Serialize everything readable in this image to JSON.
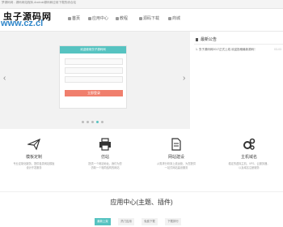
{
  "topbar": {
    "text": "梦源码网 - 源码网站程序,Android源码和应用下载的综合站"
  },
  "logo": {
    "cn": "虫子源码网",
    "url": "www.cz.cl"
  },
  "nav": {
    "items": [
      {
        "label": "首页",
        "active": true
      },
      {
        "label": "应用中心"
      },
      {
        "label": "教程"
      },
      {
        "label": "源码下载"
      },
      {
        "label": "商城"
      }
    ]
  },
  "slider": {
    "panel_title": "欢迎使用虫子源码网",
    "button_label": "立即登录",
    "dots": 5,
    "active_dot": 3
  },
  "announce": {
    "title": "最新公告",
    "items": [
      {
        "text": "1. 虫子源码网2017正式上线 欢迎投稿最新源码！",
        "date": "03-03"
      }
    ]
  },
  "features": [
    {
      "icon": "paper-plane-icon",
      "title": "模板定制",
      "desc": "专业定制化服务，提供各类网站模板\n设计开发服务"
    },
    {
      "icon": "printer-icon",
      "title": "仿站",
      "desc": "提供一个网站地址，我们为您\n仿制一个相同结构的网站"
    },
    {
      "icon": "document-icon",
      "title": "网站建设",
      "desc": "从需求分析到上线运营，为您提供\n一站式网站建设服务"
    },
    {
      "icon": "gears-icon",
      "title": "主机域名",
      "desc": "稳定的虚拟主机、VPS、云服务器，\n以及域名注册服务"
    }
  ],
  "section": {
    "title": "应用中心(主题、插件)",
    "tabs": [
      {
        "label": "最新上架",
        "active": true
      },
      {
        "label": "热门应用"
      },
      {
        "label": "免费下载"
      },
      {
        "label": "下载排行"
      }
    ]
  },
  "colors": {
    "accent": "#56c3c1",
    "button": "#f07f6d",
    "brand_url": "#2f86c9"
  }
}
